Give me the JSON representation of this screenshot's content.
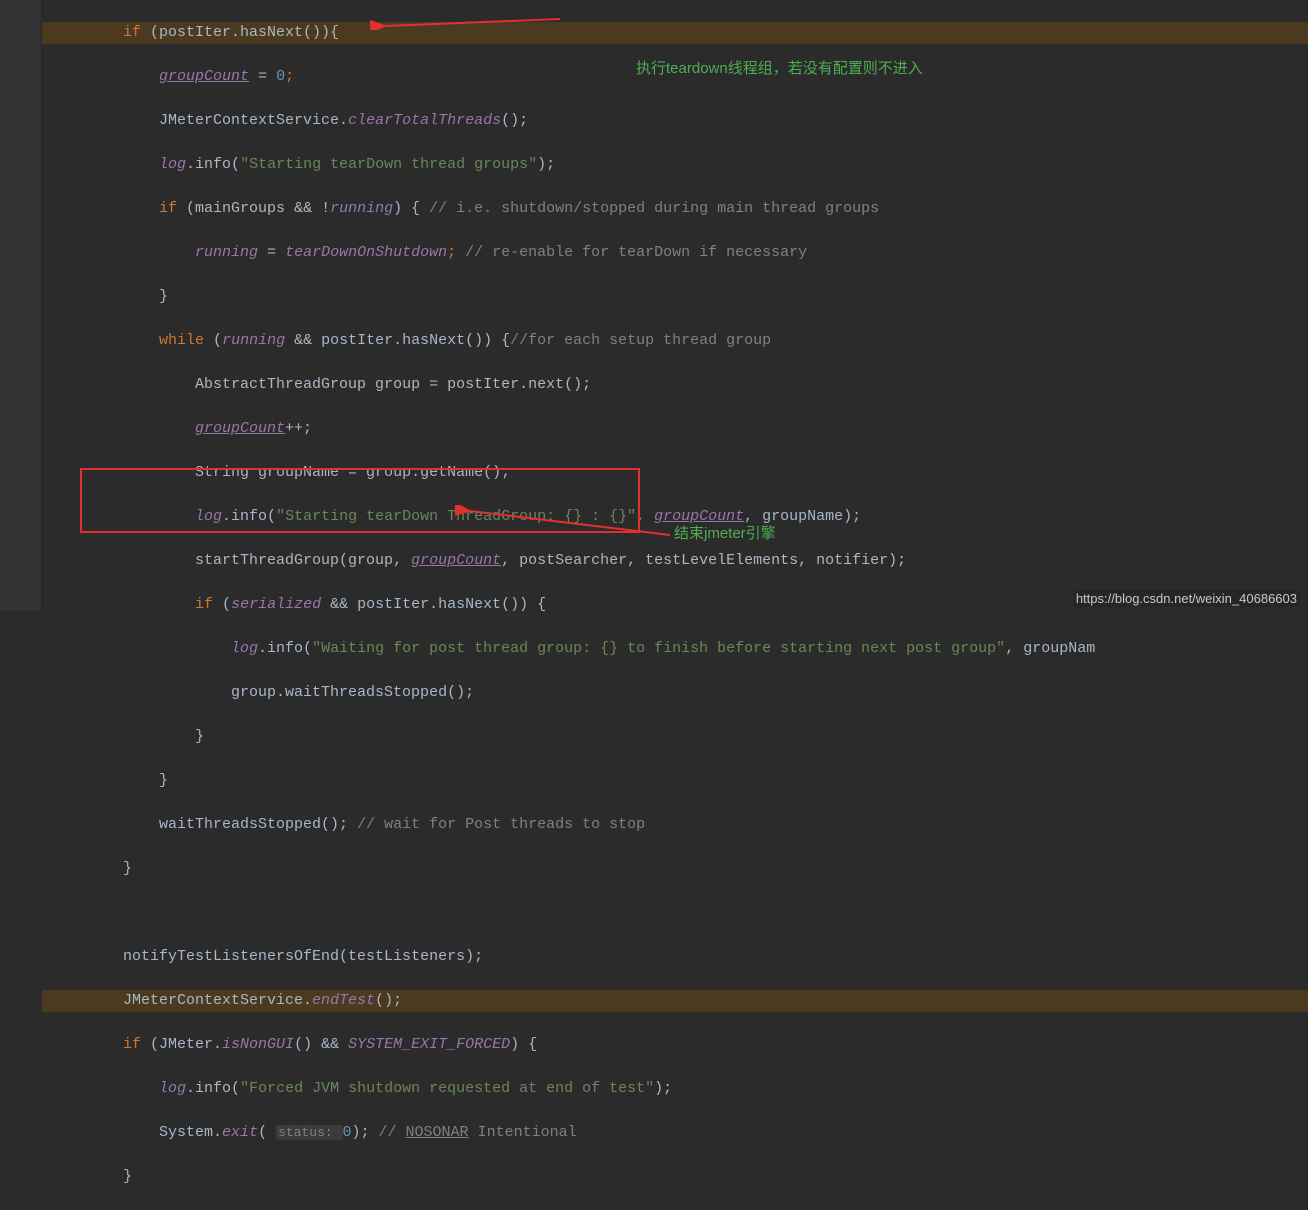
{
  "annotations": {
    "a1": "执行teardown线程组，若没有配置则不进入",
    "a2": "结束jmeter引擎"
  },
  "watermark": "https://blog.csdn.net/weixin_40686603",
  "code": {
    "l1_kw": "if ",
    "l1_a": "(postIter.hasNext()){",
    "l2_a": "groupCount",
    "l2_b": " = ",
    "l2_c": "0",
    "l2_d": ";",
    "l3_a": "JMeterContextService.",
    "l3_b": "clearTotalThreads",
    "l3_c": "();",
    "l4_a": "log",
    "l4_b": ".info(",
    "l4_c": "\"Starting tearDown thread groups\"",
    "l4_d": ");",
    "l5_kw": "if ",
    "l5_a": "(mainGroups && !",
    "l5_b": "running",
    "l5_c": ") { ",
    "l5_d": "// i.e. shutdown/stopped during main thread groups",
    "l6_a": "running",
    "l6_b": " = ",
    "l6_c": "tearDownOnShutdown",
    "l6_d": "; ",
    "l6_e": "// re-enable for tearDown if necessary",
    "l7_a": "}",
    "l8_kw": "while ",
    "l8_a": "(",
    "l8_b": "running",
    "l8_c": " && postIter.hasNext()) {",
    "l8_d": "//for each setup thread group",
    "l9_a": "AbstractThreadGroup group = postIter.next();",
    "l10_a": "groupCount",
    "l10_b": "++;",
    "l11_a": "String groupName = group.getName();",
    "l12_a": "log",
    "l12_b": ".info(",
    "l12_c": "\"Starting tearDown ThreadGroup: {} : {}\"",
    "l12_d": ", ",
    "l12_e": "groupCount",
    "l12_f": ", groupName);",
    "l13_a": "startThreadGroup(group, ",
    "l13_b": "groupCount",
    "l13_c": ", postSearcher, testLevelElements, notifier);",
    "l14_kw": "if ",
    "l14_a": "(",
    "l14_b": "serialized",
    "l14_c": " && postIter.hasNext()) {",
    "l15_a": "log",
    "l15_b": ".info(",
    "l15_c": "\"Waiting for post thread group: {} to finish before starting next post group\"",
    "l15_d": ", groupNam",
    "l16_a": "group.waitThreadsStopped();",
    "l17_a": "}",
    "l18_a": "}",
    "l19_a": "waitThreadsStopped(); ",
    "l19_b": "// wait for Post threads to stop",
    "l20_a": "}",
    "l22_a": "notifyTestListenersOfEnd(testListeners);",
    "l23_a": "JMeterContextService.",
    "l23_b": "endTest",
    "l23_c": "();",
    "l24_kw": "if ",
    "l24_a": "(JMeter.",
    "l24_b": "isNonGUI",
    "l24_c": "() && ",
    "l24_d": "SYSTEM_EXIT_FORCED",
    "l24_e": ") {",
    "l25_a": "log",
    "l25_b": ".info(",
    "l25_c": "\"Forced JVM shutdown requested at end of test\"",
    "l25_d": ");",
    "l26_a": "System.",
    "l26_b": "exit",
    "l26_c": "( ",
    "l26_hint": "status: ",
    "l26_d": "0",
    "l26_e": "); ",
    "l26_f": "// ",
    "l26_g": "NOSONAR",
    "l26_h": " Intentional",
    "l27_a": "}"
  }
}
